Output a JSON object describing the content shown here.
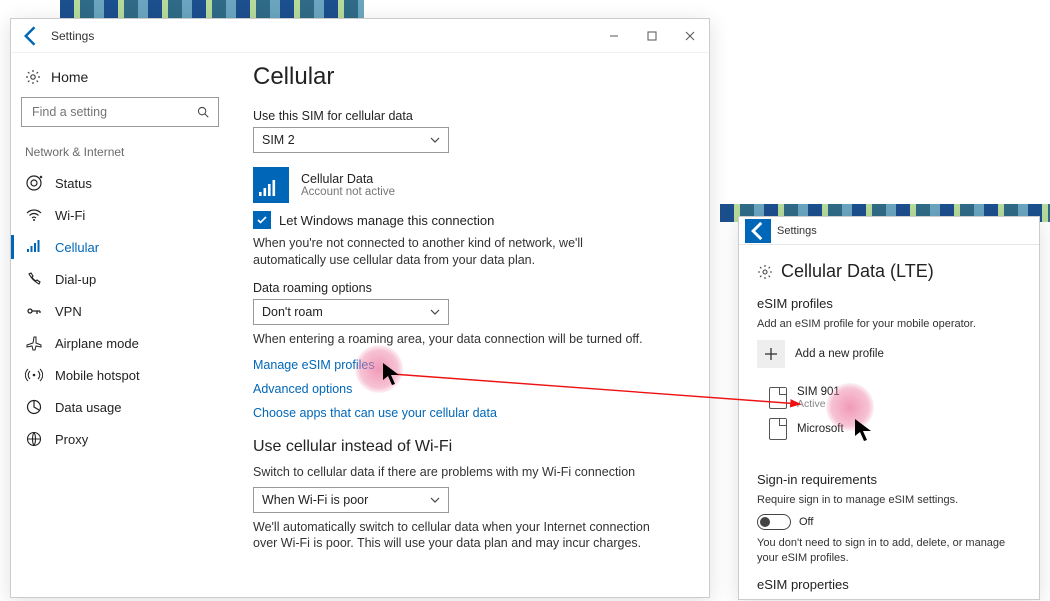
{
  "left": {
    "title": "Settings",
    "home": "Home",
    "search_placeholder": "Find a setting",
    "group": "Network & Internet",
    "nav": [
      {
        "icon": "status",
        "label": "Status"
      },
      {
        "icon": "wifi",
        "label": "Wi-Fi"
      },
      {
        "icon": "cellular",
        "label": "Cellular",
        "active": true
      },
      {
        "icon": "dialup",
        "label": "Dial-up"
      },
      {
        "icon": "vpn",
        "label": "VPN"
      },
      {
        "icon": "airplane",
        "label": "Airplane mode"
      },
      {
        "icon": "hotspot",
        "label": "Mobile hotspot"
      },
      {
        "icon": "data",
        "label": "Data usage"
      },
      {
        "icon": "proxy",
        "label": "Proxy"
      }
    ],
    "heading": "Cellular",
    "sim_label": "Use this SIM for cellular data",
    "sim_value": "SIM 2",
    "tile_title": "Cellular Data",
    "tile_sub": "Account not active",
    "manage_check": "Let Windows manage this connection",
    "manage_desc": "When you're not connected to another kind of network, we'll automatically use cellular data from your data plan.",
    "roam_label": "Data roaming options",
    "roam_value": "Don't roam",
    "roam_desc": "When entering a roaming area, your data connection will be turned off.",
    "links": {
      "esim": "Manage eSIM profiles",
      "adv": "Advanced options",
      "apps": "Choose apps that can use your cellular data"
    },
    "fallback_heading": "Use cellular instead of Wi-Fi",
    "fallback_label": "Switch to cellular data if there are problems with my Wi-Fi connection",
    "fallback_value": "When Wi-Fi is poor",
    "fallback_desc": "We'll automatically switch to cellular data when your Internet connection over Wi-Fi is poor. This will use your data plan and may incur charges."
  },
  "right": {
    "title": "Settings",
    "heading": "Cellular Data (LTE)",
    "profiles_heading": "eSIM profiles",
    "profiles_desc": "Add an eSIM profile for your mobile operator.",
    "add_label": "Add a new profile",
    "profiles": [
      {
        "name": "SIM 901",
        "status": "Active"
      },
      {
        "name": "Microsoft",
        "status": ""
      }
    ],
    "signin_heading": "Sign-in requirements",
    "signin_desc": "Require sign in to manage eSIM settings.",
    "toggle_label": "Off",
    "signin_note": "You don't need to sign in to add, delete, or manage your eSIM profiles.",
    "props_heading": "eSIM properties"
  }
}
